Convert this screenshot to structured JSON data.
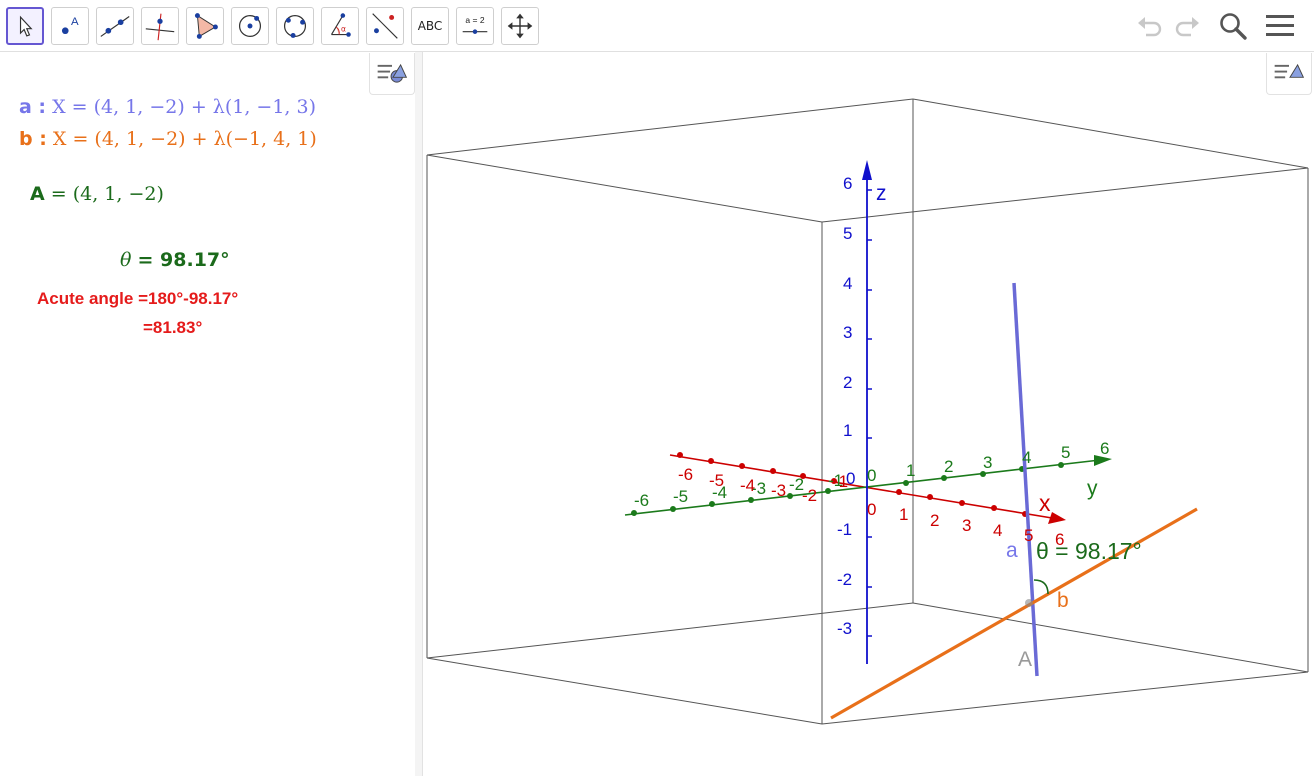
{
  "toolbar": {
    "tools": [
      {
        "name": "move-tool"
      },
      {
        "name": "point-tool",
        "label": "A"
      },
      {
        "name": "line-tool"
      },
      {
        "name": "perpendicular-line-tool"
      },
      {
        "name": "polygon-tool"
      },
      {
        "name": "circle-tool"
      },
      {
        "name": "conic-tool"
      },
      {
        "name": "angle-tool"
      },
      {
        "name": "reflect-tool"
      },
      {
        "name": "text-tool",
        "label": "ABC"
      },
      {
        "name": "slider-tool",
        "label": "a = 2"
      },
      {
        "name": "move-graphics-tool"
      }
    ],
    "right_icons": [
      "undo-icon",
      "redo-icon",
      "search-icon",
      "menu-icon"
    ]
  },
  "algebra": {
    "line_a": {
      "label": "a :",
      "equation": "X = (4, 1, −2) + λ(1, −1, 3)",
      "color": "#7676e9"
    },
    "line_b": {
      "label": "b :",
      "equation": "X = (4, 1, −2) + λ(−1, 4, 1)",
      "color": "#e8701a"
    },
    "point_A": {
      "label": "A",
      "value": "= (4, 1, −2)",
      "color": "#1b6a1b"
    },
    "angle": {
      "label": "θ",
      "value": "= 98.17°",
      "color": "#1b6a1b"
    },
    "note_line1": "Acute angle =180°-98.17°",
    "note_line2": "=81.83°",
    "note_color": "#e51b1b"
  },
  "graphics3d": {
    "axes": {
      "x": {
        "label": "x",
        "color": "#cc0000",
        "ticks": [
          "-6",
          "-5",
          "-4",
          "-3",
          "-2",
          "-1",
          "0",
          "1",
          "2",
          "3",
          "4",
          "5",
          "6"
        ]
      },
      "y": {
        "label": "y",
        "color": "#1b7a1b",
        "ticks": [
          "-6",
          "-5",
          "-4",
          "-3",
          "-2",
          "-1",
          "0",
          "1",
          "2",
          "3",
          "4",
          "5",
          "6"
        ]
      },
      "z": {
        "label": "z",
        "color": "#1010cc",
        "ticks": [
          "-3",
          "-2",
          "-1",
          "0",
          "1",
          "2",
          "3",
          "4",
          "5",
          "6"
        ]
      }
    },
    "line_a_label": "a",
    "line_b_label": "b",
    "point_label": "A",
    "angle_label": "θ = 98.17°"
  }
}
